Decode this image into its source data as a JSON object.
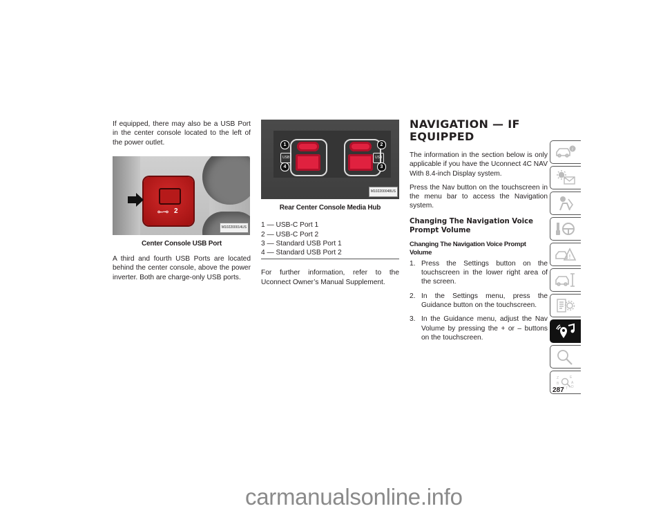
{
  "left_column": {
    "intro_text": "If equipped, there may also be a USB Port in the center console located to the left of the power outlet.",
    "figure1": {
      "port_label": "2",
      "image_code": "M102200014US",
      "caption": "Center Console USB Port"
    },
    "body_text": "A third and fourth USB Ports are located behind the center console, above the power inverter. Both are charge-only USB ports."
  },
  "middle_column": {
    "figure2": {
      "callouts": [
        "1",
        "2",
        "3",
        "4"
      ],
      "usb_label": "USB",
      "image_code": "M102200048US",
      "caption": "Rear Center Console Media Hub"
    },
    "legend": [
      "1 — USB-C Port 1",
      "2 — USB-C Port 2",
      "3 — Standard USB Port 1",
      "4 — Standard USB Port 2"
    ],
    "further_info": "For further information, refer to the Uconnect Owner’s Manual Supplement."
  },
  "right_column": {
    "section_title_line1": "NAVIGATION — IF",
    "section_title_line2": "EQUIPPED",
    "para1": "The information in the section below is only applicable if you have the Uconnect 4C NAV With 8.4-inch Display system.",
    "para2": "Press the Nav button on the touchscreen in the menu bar to access the Navigation system.",
    "subheading": "Changing The Navigation Voice Prompt Volume",
    "subsubheading": "Changing The Navigation Voice Prompt Volume",
    "steps": [
      {
        "num": "1.",
        "text": "Press the Settings button on the touchscreen in the lower right area of the screen."
      },
      {
        "num": "2.",
        "text": "In the Settings menu, press the Guidance button on the touchscreen."
      },
      {
        "num": "3.",
        "text": "In the Guidance menu, adjust the Nav Volume by pressing the + or – buttons on the touchscreen."
      }
    ]
  },
  "side_tabs": [
    {
      "icon": "car-info-icon",
      "active": false
    },
    {
      "icon": "sun-message-icon",
      "active": false
    },
    {
      "icon": "airbag-seat-icon",
      "active": false
    },
    {
      "icon": "key-steering-wheel-icon",
      "active": false
    },
    {
      "icon": "car-warning-icon",
      "active": false
    },
    {
      "icon": "car-wrench-icon",
      "active": false
    },
    {
      "icon": "specs-gear-icon",
      "active": false
    },
    {
      "icon": "navigation-music-icon",
      "active": true
    },
    {
      "icon": "search-icon",
      "active": false
    },
    {
      "icon": "index-alphabet-icon",
      "active": false
    }
  ],
  "page_number": "287",
  "watermark": "carmanualsonline.info"
}
